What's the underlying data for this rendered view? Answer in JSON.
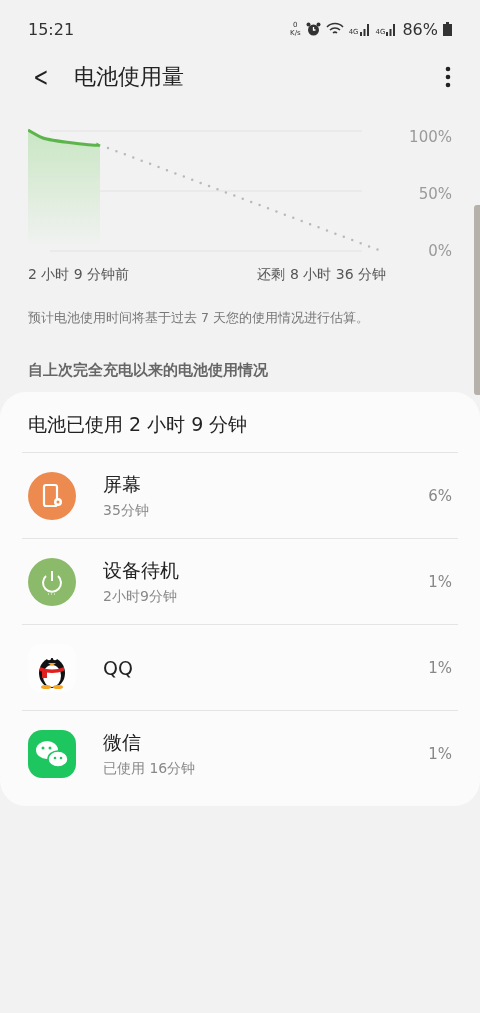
{
  "status_bar": {
    "time": "15:21",
    "speed_value": "0",
    "speed_unit": "K/s",
    "signal_1": "4G",
    "signal_2": "4G",
    "battery": "86%"
  },
  "header": {
    "back": "<",
    "title": "电池使用量"
  },
  "graph": {
    "y_labels": [
      "100%",
      "50%",
      "0%"
    ],
    "start_label": "2 小时 9 分钟前",
    "end_label": "还剩 8 小时 36 分钟"
  },
  "note": "预计电池使用时间将基于过去 7 天您的使用情况进行估算。",
  "section_title": "自上次完全充电以来的电池使用情况",
  "usage_card": {
    "title": "电池已使用 2 小时 9 分钟",
    "items": [
      {
        "kind": "screen",
        "name": "屏幕",
        "detail": "35分钟",
        "percent": "6%"
      },
      {
        "kind": "standby",
        "name": "设备待机",
        "detail": "2小时9分钟",
        "percent": "1%"
      },
      {
        "kind": "penguin",
        "name": "QQ",
        "percent": "1%"
      },
      {
        "kind": "chat",
        "name": "微信",
        "detail": "已使用 16分钟",
        "percent": "1%"
      }
    ]
  }
}
